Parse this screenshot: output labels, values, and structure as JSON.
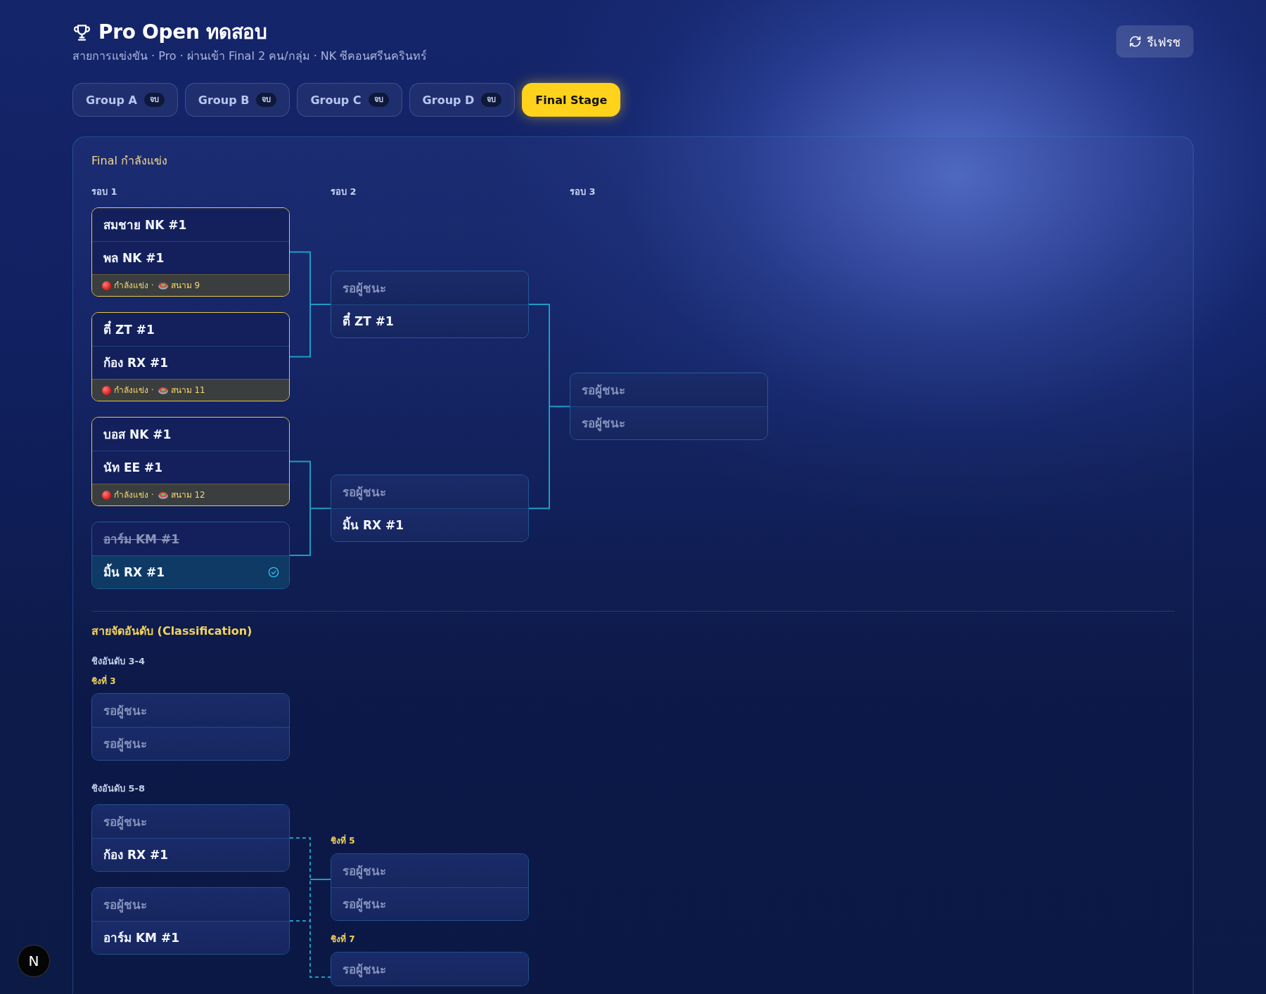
{
  "header": {
    "title": "Pro Open ทดสอบ",
    "subtitle": "สายการแข่งขัน · Pro · ผ่านเข้า Final 2 คน/กลุ่ม · NK ซีคอนศรีนครินทร์",
    "refresh_button": "รีเฟรช"
  },
  "tabs": [
    {
      "label": "Group A",
      "badge": "จบ",
      "selected": false
    },
    {
      "label": "Group B",
      "badge": "จบ",
      "selected": false
    },
    {
      "label": "Group C",
      "badge": "จบ",
      "selected": false
    },
    {
      "label": "Group D",
      "badge": "จบ",
      "selected": false
    },
    {
      "label": "Final Stage",
      "selected": true
    }
  ],
  "final": {
    "title": "Final กำลังแข่ง",
    "rounds": [
      {
        "label": "รอบ 1",
        "matches": [
          {
            "kind": "live",
            "slots": [
              {
                "kind": "team",
                "name": "สมชาย NK #1",
                "winner": false
              },
              {
                "kind": "team",
                "name": "พล NK #1",
                "winner": false
              }
            ],
            "status": "กำลังแข่ง ·",
            "court": "สนาม 9"
          },
          {
            "kind": "live",
            "slots": [
              {
                "kind": "team",
                "name": "ตี๋ ZT #1",
                "winner": false
              },
              {
                "kind": "team",
                "name": "ก้อง RX #1",
                "winner": false
              }
            ],
            "status": "กำลังแข่ง ·",
            "court": "สนาม 11"
          },
          {
            "kind": "live",
            "slots": [
              {
                "kind": "team",
                "name": "บอส NK #1",
                "winner": false
              },
              {
                "kind": "team",
                "name": "นัท EE #1",
                "winner": false
              }
            ],
            "status": "กำลังแข่ง ·",
            "court": "สนาม 12"
          },
          {
            "kind": "done",
            "slots": [
              {
                "kind": "team",
                "name": "อาร์ม KM #1",
                "winner": false
              },
              {
                "kind": "team",
                "name": "มิ้น RX #1",
                "winner": true
              }
            ]
          }
        ]
      },
      {
        "label": "รอบ 2",
        "matches": [
          {
            "kind": "pending",
            "slots": [
              {
                "kind": "waiting",
                "name": "รอผู้ชนะ",
                "winner": false
              },
              {
                "kind": "team",
                "name": "ตี๋ ZT #1",
                "winner": false
              }
            ]
          },
          {
            "kind": "pending",
            "slots": [
              {
                "kind": "waiting",
                "name": "รอผู้ชนะ",
                "winner": false
              },
              {
                "kind": "team",
                "name": "มิ้น RX #1",
                "winner": false
              }
            ]
          }
        ]
      },
      {
        "label": "รอบ 3",
        "matches": [
          {
            "kind": "pending",
            "slots": [
              {
                "kind": "waiting",
                "name": "รอผู้ชนะ",
                "winner": false
              },
              {
                "kind": "waiting",
                "name": "รอผู้ชนะ",
                "winner": false
              }
            ]
          }
        ]
      }
    ]
  },
  "classification": {
    "title": "สายจัดอันดับ (Classification)",
    "groups": [
      {
        "title": "ชิงอันดับ 3-4",
        "kind": "single",
        "matches": [
          {
            "label": "ชิงที่ 3",
            "kind": "pending",
            "slots": [
              {
                "kind": "waiting",
                "name": "รอผู้ชนะ",
                "winner": false
              },
              {
                "kind": "waiting",
                "name": "รอผู้ชนะ",
                "winner": false
              }
            ]
          }
        ]
      },
      {
        "title": "ชิงอันดับ 5-8",
        "kind": "bracket",
        "feeders": [
          {
            "kind": "pending",
            "slots": [
              {
                "kind": "waiting",
                "name": "รอผู้ชนะ",
                "winner": false
              },
              {
                "kind": "team",
                "name": "ก้อง RX #1",
                "winner": false
              }
            ]
          },
          {
            "kind": "pending",
            "slots": [
              {
                "kind": "waiting",
                "name": "รอผู้ชนะ",
                "winner": false
              },
              {
                "kind": "team",
                "name": "อาร์ม KM #1",
                "winner": false
              }
            ]
          }
        ],
        "matches": [
          {
            "label": "ชิงที่ 5",
            "kind": "pending",
            "slots": [
              {
                "kind": "waiting",
                "name": "รอผู้ชนะ",
                "winner": false
              },
              {
                "kind": "waiting",
                "name": "รอผู้ชนะ",
                "winner": false
              }
            ]
          },
          {
            "label": "ชิงที่ 7",
            "kind": "pending",
            "slots": [
              {
                "kind": "waiting",
                "name": "รอผู้ชนะ",
                "winner": false
              }
            ]
          }
        ]
      }
    ]
  },
  "dev_badge": {
    "label": "N"
  }
}
